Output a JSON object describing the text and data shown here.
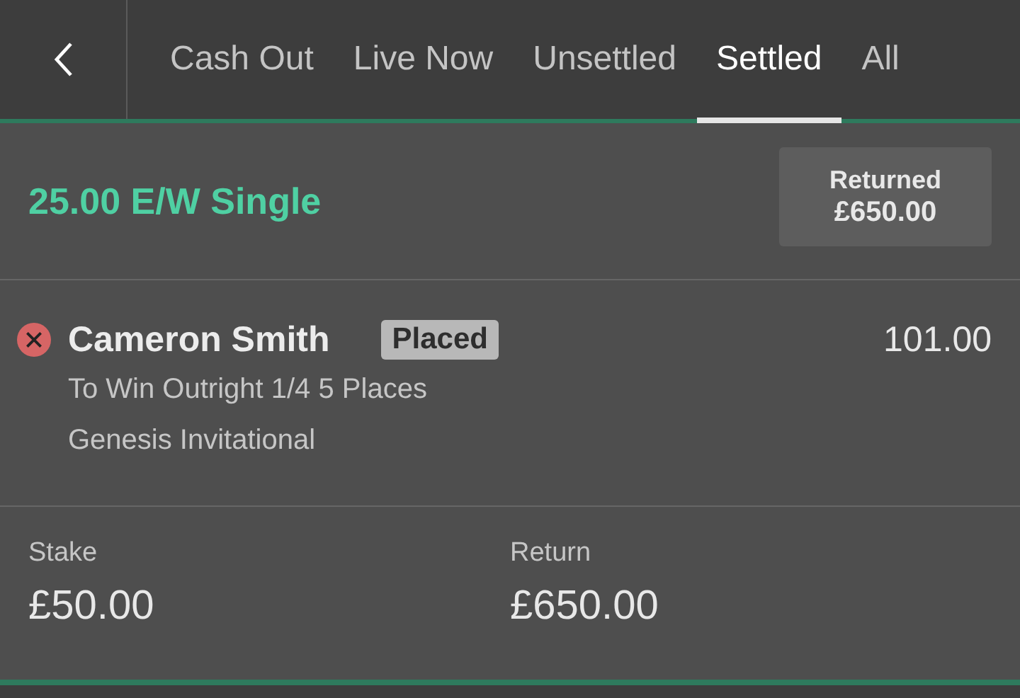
{
  "tabs": [
    {
      "label": "Cash Out",
      "selected": false
    },
    {
      "label": "Live Now",
      "selected": false
    },
    {
      "label": "Unsettled",
      "selected": false
    },
    {
      "label": "Settled",
      "selected": true
    },
    {
      "label": "All",
      "selected": false
    }
  ],
  "bet": {
    "title": "25.00 E/W Single",
    "returned": {
      "label": "Returned",
      "amount": "£650.00"
    },
    "selections": [
      {
        "lost": true,
        "name": "Cameron Smith",
        "badge": "Placed",
        "odds": "101.00",
        "market": "To Win Outright 1/4 5 Places",
        "event": "Genesis Invitational"
      }
    ],
    "stake": {
      "label": "Stake",
      "value": "£50.00"
    },
    "return": {
      "label": "Return",
      "value": "£650.00"
    }
  }
}
